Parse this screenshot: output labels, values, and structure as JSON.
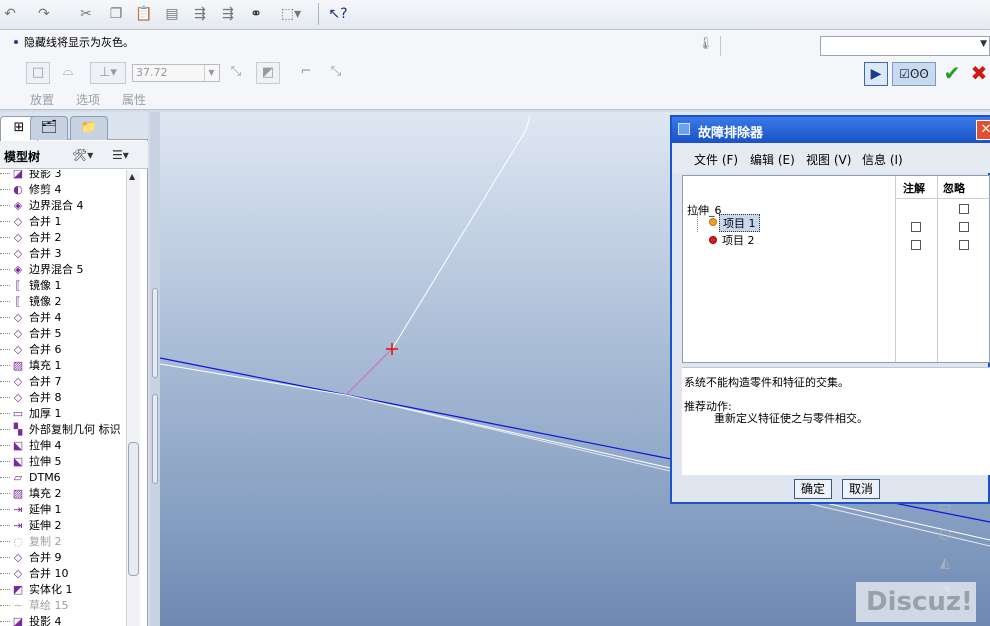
{
  "dashboard": {
    "message": "隐藏线将显示为灰色。",
    "depth_value": "37.72",
    "tabs": [
      "放置",
      "选项",
      "属性"
    ],
    "preview_icon": "glasses-icon"
  },
  "model_tree": {
    "title": "模型树",
    "items": [
      {
        "label": "投影 3",
        "icon": "projection-icon",
        "dim": false
      },
      {
        "label": "修剪 4",
        "icon": "trim-icon",
        "dim": false
      },
      {
        "label": "边界混合 4",
        "icon": "boundary-blend-icon",
        "dim": false
      },
      {
        "label": "合并 1",
        "icon": "merge-icon",
        "dim": false
      },
      {
        "label": "合并 2",
        "icon": "merge-icon",
        "dim": false
      },
      {
        "label": "合并 3",
        "icon": "merge-icon",
        "dim": false
      },
      {
        "label": "边界混合 5",
        "icon": "boundary-blend-icon",
        "dim": false
      },
      {
        "label": "镜像 1",
        "icon": "mirror-icon",
        "dim": false
      },
      {
        "label": "镜像 2",
        "icon": "mirror-icon",
        "dim": false
      },
      {
        "label": "合并 4",
        "icon": "merge-icon",
        "dim": false
      },
      {
        "label": "合并 5",
        "icon": "merge-icon",
        "dim": false
      },
      {
        "label": "合并 6",
        "icon": "merge-icon",
        "dim": false
      },
      {
        "label": "填充 1",
        "icon": "fill-icon",
        "dim": false
      },
      {
        "label": "合并 7",
        "icon": "merge-icon",
        "dim": false
      },
      {
        "label": "合并 8",
        "icon": "merge-icon",
        "dim": false
      },
      {
        "label": "加厚 1",
        "icon": "thicken-icon",
        "dim": false
      },
      {
        "label": "外部复制几何 标识",
        "icon": "external-copy-icon",
        "dim": false
      },
      {
        "label": "拉伸 4",
        "icon": "extrude-icon",
        "dim": false
      },
      {
        "label": "拉伸 5",
        "icon": "extrude-icon",
        "dim": false
      },
      {
        "label": "DTM6",
        "icon": "datum-plane-icon",
        "dim": false
      },
      {
        "label": "填充 2",
        "icon": "fill-icon",
        "dim": false
      },
      {
        "label": "延伸 1",
        "icon": "extend-icon",
        "dim": false
      },
      {
        "label": "延伸 2",
        "icon": "extend-icon",
        "dim": false
      },
      {
        "label": "复制 2",
        "icon": "copy-icon",
        "dim": true
      },
      {
        "label": "合并 9",
        "icon": "merge-icon",
        "dim": false
      },
      {
        "label": "合并 10",
        "icon": "merge-icon",
        "dim": false
      },
      {
        "label": "实体化 1",
        "icon": "solidify-icon",
        "dim": false
      },
      {
        "label": "草绘 15",
        "icon": "sketch-icon",
        "dim": true
      },
      {
        "label": "投影 4",
        "icon": "projection-icon",
        "dim": false
      }
    ]
  },
  "dialog": {
    "title": "故障排除器",
    "menu": [
      "文件 (F)",
      "编辑 (E)",
      "视图 (V)",
      "信息 (I)"
    ],
    "col_note": "注解",
    "col_ignore": "忽略",
    "feature": "拉伸_6",
    "item1": "项目 1",
    "item2": "项目 2",
    "message": "系统不能构造零件和特征的交集。",
    "action_label": "推荐动作:",
    "action_text": "重新定义特征使之与零件相交。",
    "ok": "确定",
    "cancel": "取消"
  },
  "watermark": "Discuz!"
}
